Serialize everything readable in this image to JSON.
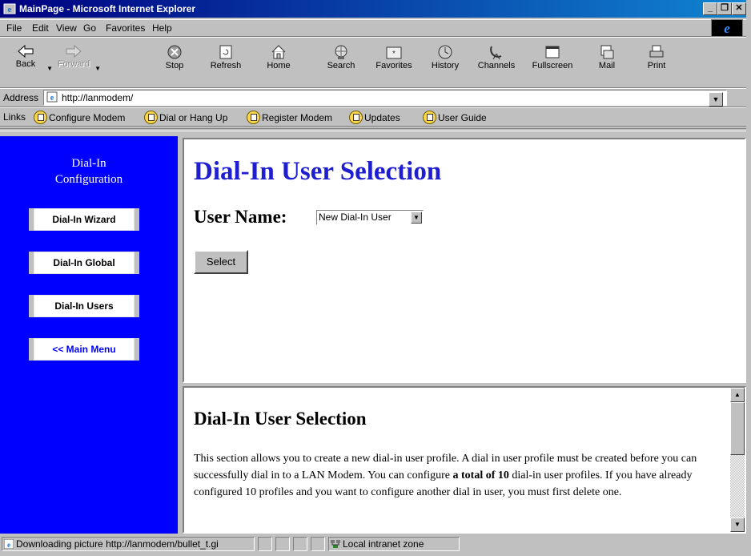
{
  "window": {
    "title": "MainPage - Microsoft Internet Explorer"
  },
  "menu": {
    "items": [
      "File",
      "Edit",
      "View",
      "Go",
      "Favorites",
      "Help"
    ]
  },
  "toolbar": {
    "buttons": [
      {
        "label": "Back",
        "icon": "back-arrow-icon"
      },
      {
        "label": "Forward",
        "icon": "forward-arrow-icon"
      },
      {
        "label": "Stop",
        "icon": "stop-icon"
      },
      {
        "label": "Refresh",
        "icon": "refresh-icon"
      },
      {
        "label": "Home",
        "icon": "home-icon"
      },
      {
        "label": "Search",
        "icon": "search-globe-icon"
      },
      {
        "label": "Favorites",
        "icon": "favorites-icon"
      },
      {
        "label": "History",
        "icon": "history-icon"
      },
      {
        "label": "Channels",
        "icon": "channels-icon"
      },
      {
        "label": "Fullscreen",
        "icon": "fullscreen-icon"
      },
      {
        "label": "Mail",
        "icon": "mail-icon"
      },
      {
        "label": "Print",
        "icon": "print-icon"
      }
    ]
  },
  "address": {
    "label": "Address",
    "value": "http://lanmodem/"
  },
  "links": {
    "label": "Links",
    "items": [
      "Configure Modem",
      "Dial or Hang Up",
      "Register Modem",
      "Updates",
      "User Guide"
    ]
  },
  "sidebar": {
    "title_line1": "Dial-In",
    "title_line2": "Configuration",
    "buttons": [
      "Dial-In Wizard",
      "Dial-In Global",
      "Dial-In Users",
      "<< Main Menu"
    ]
  },
  "main": {
    "heading": "Dial-In User Selection",
    "user_name_label": "User Name:",
    "user_select_value": "New Dial-In User",
    "select_button": "Select"
  },
  "help": {
    "heading": "Dial-In User Selection",
    "text_part1": "This section allows you to create a new dial-in user profile. A dial in user profile must be created before you can successfully dial in to a LAN Modem. You can configure ",
    "text_bold": "a total of 10",
    "text_part2": " dial-in user profiles. If you have already configured 10 profiles and you want to configure another dial in user, you must first delete one."
  },
  "status": {
    "message": "Downloading picture http://lanmodem/bullet_t.gi",
    "zone": "Local intranet zone"
  },
  "colors": {
    "sidebar_bg": "#0000ff",
    "heading": "#1e1ed0",
    "titlebar": "#000080"
  }
}
